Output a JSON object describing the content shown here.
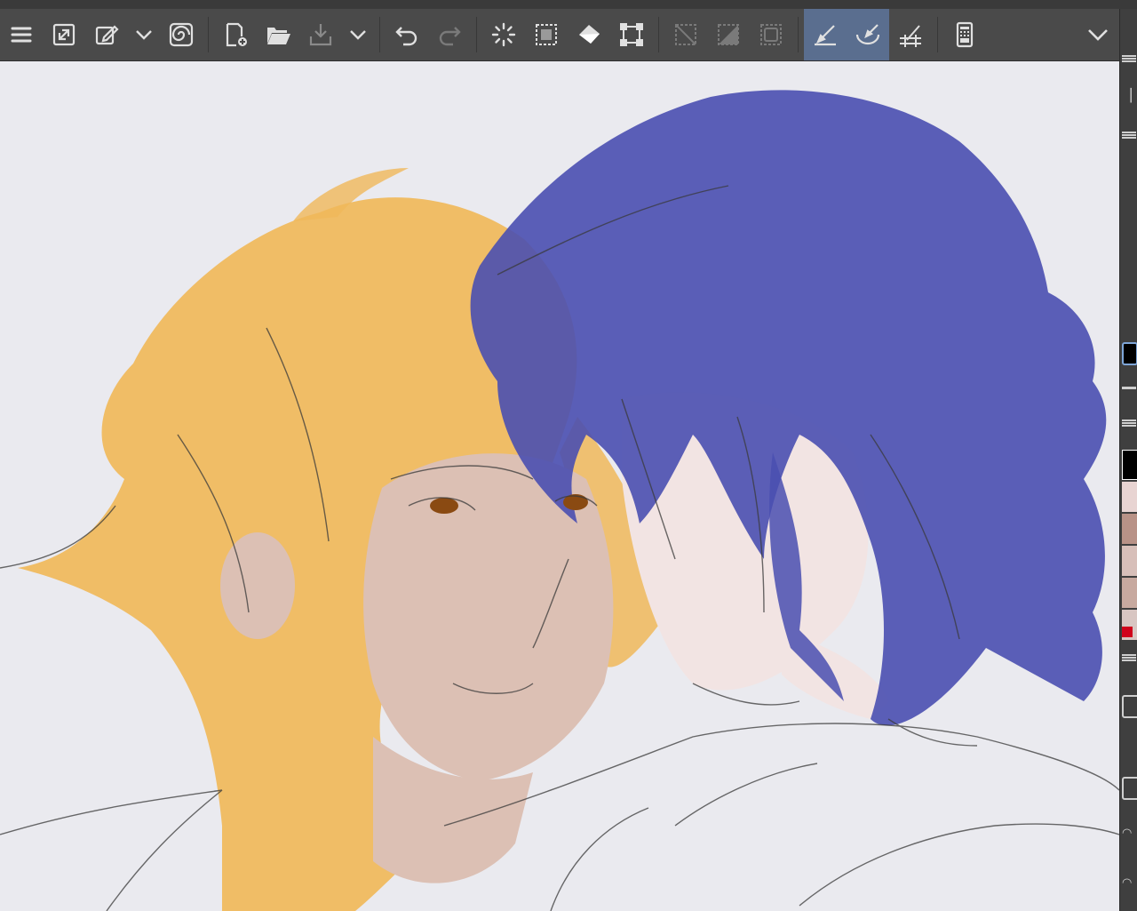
{
  "toolbar": {
    "items": [
      {
        "name": "menu-icon",
        "active": false
      },
      {
        "name": "fit-canvas-icon",
        "active": false
      },
      {
        "name": "edit-transform-icon",
        "active": false
      },
      {
        "name": "chevron-down-icon",
        "active": false
      },
      {
        "name": "spiral-companion-icon",
        "active": false
      },
      {
        "name": "new-file-icon",
        "active": false
      },
      {
        "name": "open-folder-icon",
        "active": false
      },
      {
        "name": "save-icon",
        "active": false
      },
      {
        "name": "chevron-down-icon",
        "active": false
      },
      {
        "name": "undo-icon",
        "active": false
      },
      {
        "name": "redo-icon",
        "active": false
      },
      {
        "name": "clear-icon",
        "active": false
      },
      {
        "name": "select-invert-icon",
        "active": false
      },
      {
        "name": "fill-bucket-icon",
        "active": false
      },
      {
        "name": "transform-icon",
        "active": false
      },
      {
        "name": "deselect-icon",
        "active": false
      },
      {
        "name": "invert-selection-icon",
        "active": false
      },
      {
        "name": "selection-border-icon",
        "active": false
      },
      {
        "name": "ruler-snap-icon",
        "active": true
      },
      {
        "name": "special-ruler-snap-icon",
        "active": true
      },
      {
        "name": "grid-snap-icon",
        "active": false
      },
      {
        "name": "device-icon",
        "active": false
      },
      {
        "name": "chevron-down-icon",
        "active": false
      }
    ]
  },
  "palette": {
    "main_color": "#000000",
    "swatches": [
      "#000000",
      "#e8d4d2",
      "#b89287",
      "#d7bfb9",
      "#c7a99f",
      "#d8c6c2"
    ],
    "accent_red": "#d0021b"
  },
  "canvas": {
    "background": "#eaeaef",
    "hair_orange": "#f0b85a",
    "hair_blue": "#4a4fb0",
    "skin_left": "#dcc0b4",
    "skin_right": "#f2e4e3"
  }
}
